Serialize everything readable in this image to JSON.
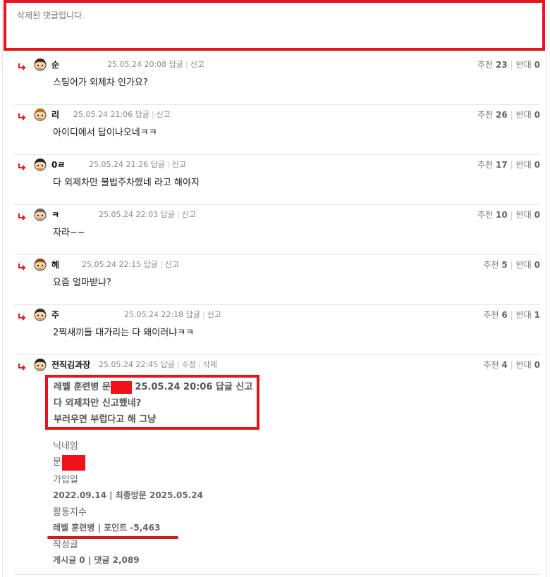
{
  "deleted_notice": "삭제된 댓글입니다.",
  "labels": {
    "reply": "답글",
    "report": "신고",
    "edit": "수정",
    "delete": "삭제",
    "recommend": "추천",
    "oppose": "반대"
  },
  "comments": [
    {
      "nick": "순",
      "time": "25.05.24 20:08",
      "text": "스팅어가 외제차 인가요?",
      "up": "23",
      "down": "0"
    },
    {
      "nick": "리",
      "time": "25.05.24 21:06",
      "text": "아이디에서 답이나오네ㅋㅋ",
      "up": "26",
      "down": "0"
    },
    {
      "nick": "0ㄹ",
      "time": "25.05.24 21:26",
      "text": "다 외제차만 불법주차했네 라고 해야지",
      "up": "17",
      "down": "0"
    },
    {
      "nick": "ㅋ",
      "time": "25.05.24 22:03",
      "text": "자라~~",
      "up": "10",
      "down": "0"
    },
    {
      "nick": "헤",
      "time": "25.05.24 22:15",
      "text": "요즘 얼마받냐?",
      "up": "5",
      "down": "0"
    },
    {
      "nick": "주",
      "time": "25.05.24 22:18",
      "text": "2찍새끼들 대가리는 다 왜이러냐ㅋㅋ",
      "up": "6",
      "down": "1"
    }
  ],
  "last_comment": {
    "nick": "전직김과장",
    "time": "25.05.24 22:45",
    "up": "4",
    "down": "0",
    "quote": {
      "header_prefix": "레벨 훈련병 문",
      "header_suffix": "25.05.24 20:06 답글 신고",
      "line1": "다 외제차만 신고했네?",
      "line2": "부러우면 부럽다고 해 그냥"
    },
    "profile": {
      "nickname_label": "닉네임",
      "nickname_value": "문",
      "join_label": "가입일",
      "join_value": "2022.09.14 | 최종방문 2025.05.24",
      "activity_label": "활동지수",
      "activity_value": "레벨 훈련병 | 포인트 -5,463",
      "posts_label": "작성글",
      "posts_value": "게시글 0 | 댓글 2,089"
    }
  },
  "colors": {
    "highlight": "#e8141c",
    "reply_arrow": "#e8141c"
  }
}
